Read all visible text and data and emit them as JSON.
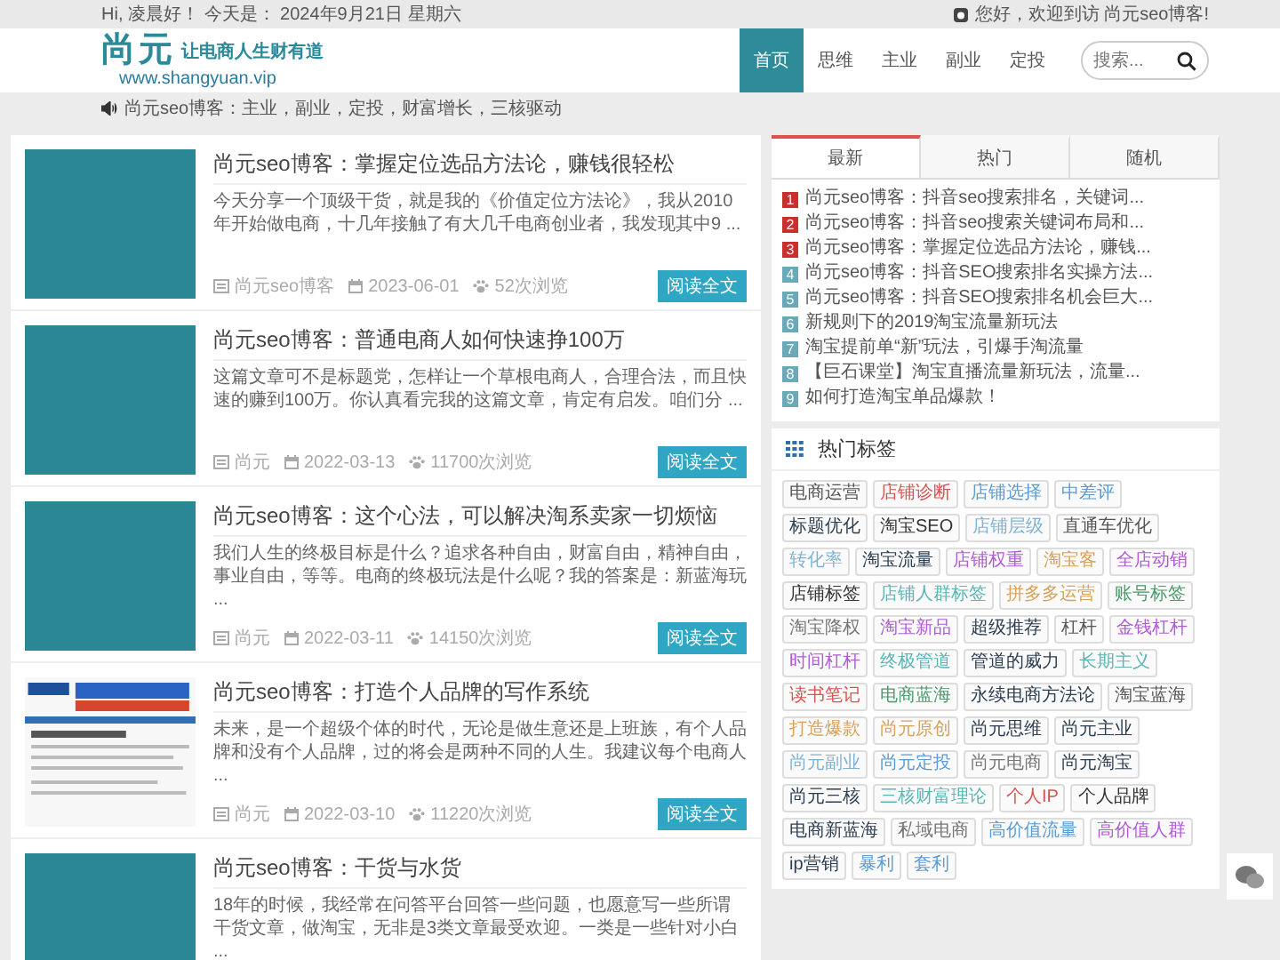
{
  "topbar": {
    "greeting": "Hi, 凌晨好！ 今天是： 2024年9月21日 星期六",
    "welcome": "您好，欢迎到访 尚元seo博客!"
  },
  "header": {
    "logo_title": "尚元",
    "logo_slogan": "让电商人生财有道",
    "logo_url": "www.shangyuan.vip",
    "nav": [
      {
        "label": "首页",
        "selected": true
      },
      {
        "label": "思维",
        "selected": false
      },
      {
        "label": "主业",
        "selected": false
      },
      {
        "label": "副业",
        "selected": false
      },
      {
        "label": "定投",
        "selected": false
      }
    ],
    "search": {
      "placeholder": "搜索..."
    }
  },
  "notice": "尚元seo博客：主业，副业，定投，财富增长，三核驱动",
  "posts": [
    {
      "title": "尚元seo博客：掌握定位选品方法论，赚钱很轻松",
      "excerpt": "今天分享一个顶级干货，就是我的《价值定位方法论》，我从2010年开始做电商，十几年接触了有大几千电商创业者，我发现其中9 ...",
      "author": "尚元seo博客",
      "date": "2023-06-01",
      "views": "52次浏览",
      "button": "阅读全文"
    },
    {
      "title": "尚元seo博客：普通电商人如何快速挣100万",
      "excerpt": "这篇文章可不是标题党，怎样让一个草根电商人，合理合法，而且快速的赚到100万。你认真看完我的这篇文章，肯定有启发。咱们分 ...",
      "author": "尚元",
      "date": "2022-03-13",
      "views": "11700次浏览",
      "button": "阅读全文"
    },
    {
      "title": "尚元seo博客：这个心法，可以解决淘系卖家一切烦恼",
      "excerpt": "我们人生的终极目标是什么？追求各种自由，财富自由，精神自由，事业自由，等等。电商的终极玩法是什么呢？我的答案是：新蓝海玩 ...",
      "author": "尚元",
      "date": "2022-03-11",
      "views": "14150次浏览",
      "button": "阅读全文"
    },
    {
      "title": "尚元seo博客：打造个人品牌的写作系统",
      "excerpt": "未来，是一个超级个体的时代，无论是做生意还是上班族，有个人品牌和没有个人品牌，过的将会是两种不同的人生。我建议每个电商人 ...",
      "author": "尚元",
      "date": "2022-03-10",
      "views": "11220次浏览",
      "button": "阅读全文"
    },
    {
      "title": "尚元seo博客：干货与水货",
      "excerpt": "18年的时候，我经常在问答平台回答一些问题，也愿意写一些所谓干货文章，做淘宝，无非是3类文章最受欢迎。一类是一些针对小白 ..."
    }
  ],
  "sidebar": {
    "tabs": [
      {
        "label": "最新",
        "selected": true
      },
      {
        "label": "热门",
        "selected": false
      },
      {
        "label": "随机",
        "selected": false
      }
    ],
    "articles": [
      {
        "number": "1",
        "title": "尚元seo博客：抖音seo搜索排名，关键词...",
        "color": "#c9302c"
      },
      {
        "number": "2",
        "title": "尚元seo博客：抖音seo搜索关键词布局和...",
        "color": "#c9302c"
      },
      {
        "number": "3",
        "title": "尚元seo博客：掌握定位选品方法论，赚钱...",
        "color": "#c9302c"
      },
      {
        "number": "4",
        "title": "尚元seo博客：抖音SEO搜索排名实操方法...",
        "color": "#6aaab8"
      },
      {
        "number": "5",
        "title": "尚元seo博客：抖音SEO搜索排名机会巨大...",
        "color": "#6aaab8"
      },
      {
        "number": "6",
        "title": "新规则下的2019淘宝流量新玩法",
        "color": "#6aaab8"
      },
      {
        "number": "7",
        "title": "淘宝提前单“新”玩法，引爆手淘流量",
        "color": "#6aaab8"
      },
      {
        "number": "8",
        "title": "【巨石课堂】淘宝直播流量新玩法，流量...",
        "color": "#6aaab8"
      },
      {
        "number": "9",
        "title": "如何打造淘宝单品爆款！",
        "color": "#6aaab8"
      }
    ]
  },
  "tags": {
    "title": "热门标签",
    "items": [
      {
        "label": "电商运营",
        "color": "#555555"
      },
      {
        "label": "店铺诊断",
        "color": "#d9534f"
      },
      {
        "label": "店铺选择",
        "color": "#5b9bd5"
      },
      {
        "label": "中差评",
        "color": "#5b9bd5"
      },
      {
        "label": "标题优化",
        "color": "#2c3e50"
      },
      {
        "label": "淘宝SEO",
        "color": "#333333"
      },
      {
        "label": "店铺层级",
        "color": "#7fb3d5"
      },
      {
        "label": "直通车优化",
        "color": "#555555"
      },
      {
        "label": "转化率",
        "color": "#7fb3d5"
      },
      {
        "label": "淘宝流量",
        "color": "#2c3e50"
      },
      {
        "label": "店铺权重",
        "color": "#b05ad8"
      },
      {
        "label": "淘宝客",
        "color": "#d9a05b"
      },
      {
        "label": "全店动销",
        "color": "#b05ad8"
      },
      {
        "label": "店铺标签",
        "color": "#333333"
      },
      {
        "label": "店铺人群标签",
        "color": "#5bb5b5"
      },
      {
        "label": "拼多多运营",
        "color": "#d9a05b"
      },
      {
        "label": "账号标签",
        "color": "#4a9a6a"
      },
      {
        "label": "淘宝降权",
        "color": "#777777"
      },
      {
        "label": "淘宝新品",
        "color": "#b05ad8"
      },
      {
        "label": "超级推荐",
        "color": "#2c3e50"
      },
      {
        "label": "杠杆",
        "color": "#555555"
      },
      {
        "label": "金钱杠杆",
        "color": "#b05ad8"
      },
      {
        "label": "时间杠杆",
        "color": "#b05ad8"
      },
      {
        "label": "终极管道",
        "color": "#5bb5b5"
      },
      {
        "label": "管道的威力",
        "color": "#2c3e50"
      },
      {
        "label": "长期主义",
        "color": "#5bb5b5"
      },
      {
        "label": "读书笔记",
        "color": "#d9534f"
      },
      {
        "label": "电商蓝海",
        "color": "#4a9a6a"
      },
      {
        "label": "永续电商方法论",
        "color": "#2c3e50"
      },
      {
        "label": "淘宝蓝海",
        "color": "#555555"
      },
      {
        "label": "打造爆款",
        "color": "#d9a05b"
      },
      {
        "label": "尚元原创",
        "color": "#d9a05b"
      },
      {
        "label": "尚元思维",
        "color": "#2c3e50"
      },
      {
        "label": "尚元主业",
        "color": "#2c3e50"
      },
      {
        "label": "尚元副业",
        "color": "#7fb3d5"
      },
      {
        "label": "尚元定投",
        "color": "#5b9bd5"
      },
      {
        "label": "尚元电商",
        "color": "#777777"
      },
      {
        "label": "尚元淘宝",
        "color": "#2c3e50"
      },
      {
        "label": "尚元三核",
        "color": "#2c3e50"
      },
      {
        "label": "三核财富理论",
        "color": "#5bb5b5"
      },
      {
        "label": "个人IP",
        "color": "#d9534f"
      },
      {
        "label": "个人品牌",
        "color": "#333333"
      },
      {
        "label": "电商新蓝海",
        "color": "#2c3e50"
      },
      {
        "label": "私域电商",
        "color": "#777777"
      },
      {
        "label": "高价值流量",
        "color": "#5b9bd5"
      },
      {
        "label": "高价值人群",
        "color": "#b05ad8"
      },
      {
        "label": "ip营销",
        "color": "#2c3e50"
      },
      {
        "label": "暴利",
        "color": "#5b9bd5"
      },
      {
        "label": "套利",
        "color": "#5b9bd5"
      }
    ]
  }
}
